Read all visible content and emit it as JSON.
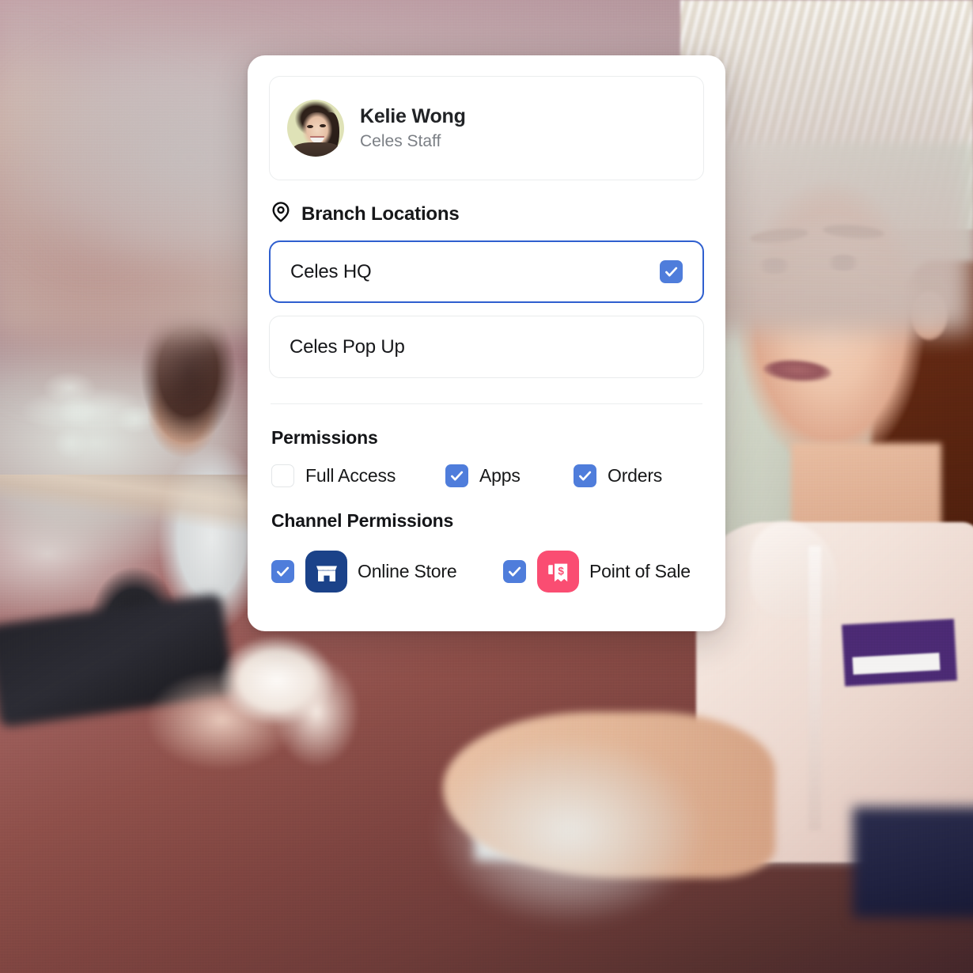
{
  "panel": {
    "profile": {
      "avatar_icon": "user-avatar-photo",
      "name": "Kelie Wong",
      "role": "Celes Staff"
    },
    "branch_section": {
      "icon": "map-pin-icon",
      "title": "Branch Locations",
      "locations": [
        {
          "label": "Celes HQ",
          "checked": true,
          "selected": true
        },
        {
          "label": "Celes Pop Up",
          "checked": false,
          "selected": false
        }
      ]
    },
    "permissions": {
      "title": "Permissions",
      "items": [
        {
          "label": "Full Access",
          "checked": false
        },
        {
          "label": "Apps",
          "checked": true
        },
        {
          "label": "Orders",
          "checked": true
        }
      ]
    },
    "channel_permissions": {
      "title": "Channel Permissions",
      "items": [
        {
          "label": "Online Store",
          "checked": true,
          "icon": "storefront-icon",
          "icon_color": "#1b4289"
        },
        {
          "label": "Point of Sale",
          "checked": true,
          "icon": "receipt-dollar-icon",
          "icon_color": "#fa4d72"
        }
      ]
    }
  },
  "colors": {
    "accent_checkbox": "#4f7ddb",
    "selected_border": "#2f5fcf",
    "online_store_icon_bg": "#1b4289",
    "point_of_sale_icon_bg": "#fa4d72",
    "panel_background": "#ffffff",
    "name_text": "#212326",
    "role_text": "#7b7f85"
  },
  "background": {
    "description": "blurred photo of retail staff member at a counter"
  }
}
